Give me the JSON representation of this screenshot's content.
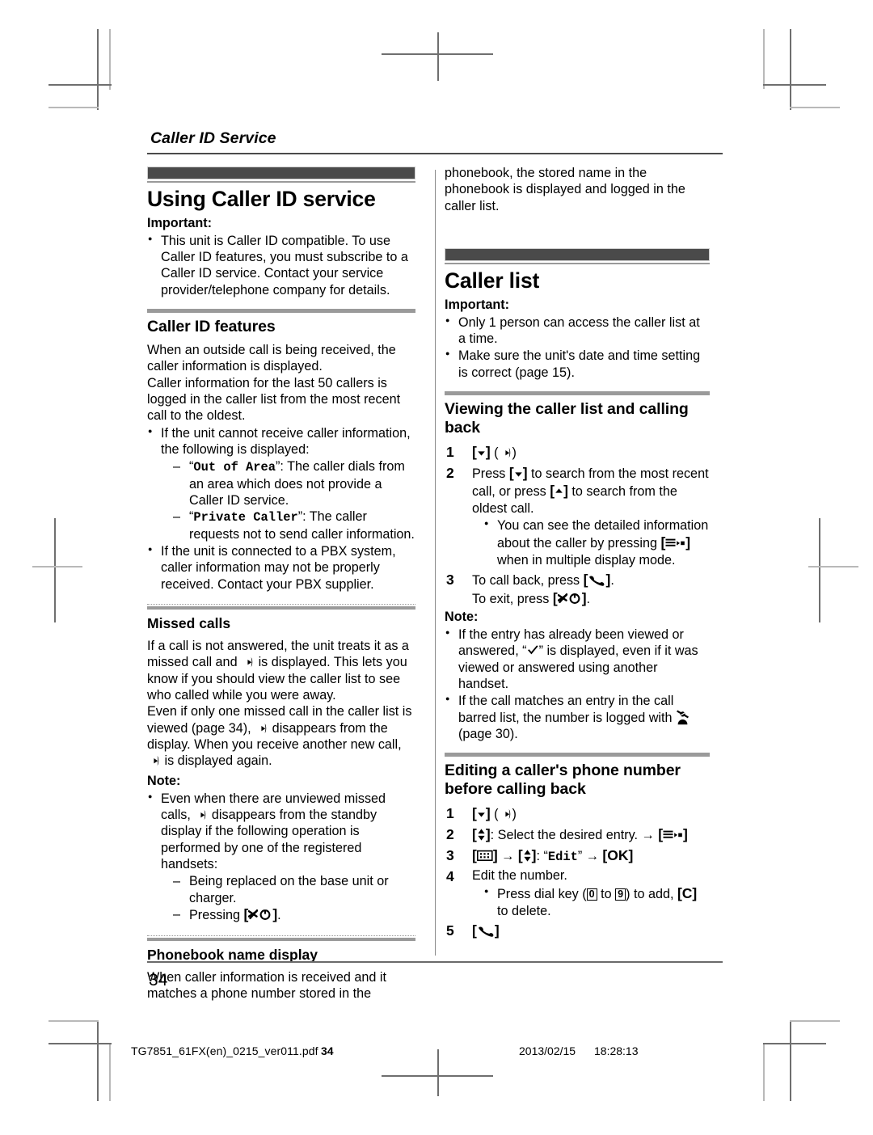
{
  "running_head": "Caller ID Service",
  "page_number": "34",
  "left_column": {
    "chapter_title": "Using Caller ID service",
    "important_label": "Important:",
    "important_bullets": [
      "This unit is Caller ID compatible. To use Caller ID features, you must subscribe to a Caller ID service. Contact your service provider/telephone company for details."
    ],
    "section_caller_id_features": {
      "heading": "Caller ID features",
      "paragraphs": [
        "When an outside call is being received, the caller information is displayed.",
        "Caller information for the last 50 callers is logged in the caller list from the most recent call to the oldest."
      ],
      "bullet_1_intro": "If the unit cannot receive caller information, the following is displayed:",
      "dash_items": [
        {
          "code": "Out of Area",
          "text": ": The caller dials from an area which does not provide a Caller ID service."
        },
        {
          "code": "Private Caller",
          "text": ": The caller requests not to send caller information."
        }
      ],
      "bullet_2": "If the unit is connected to a PBX system, caller information may not be properly received. Contact your PBX supplier."
    },
    "subsection_missed_calls": {
      "heading": "Missed calls",
      "para_1_a": "If a call is not answered, the unit treats it as a missed call and ",
      "para_1_b": " is displayed. This lets you know if you should view the caller list to see who called while you were away.",
      "para_2_a": "Even if only one missed call in the caller list is viewed (page 34), ",
      "para_2_b": " disappears from the display. When you receive another new call, ",
      "para_2_c": " is displayed again.",
      "note_label": "Note:",
      "note_bullet_a": "Even when there are unviewed missed calls, ",
      "note_bullet_b": " disappears from the standby display if the following operation is performed by one of the registered handsets:",
      "note_dash_1": "Being replaced on the base unit or charger.",
      "note_dash_2_prefix": "Pressing ",
      "note_dash_2_suffix": "."
    },
    "subsection_phonebook_name": {
      "heading": "Phonebook name display",
      "paragraph": "When caller information is received and it matches a phone number stored in the"
    }
  },
  "right_column": {
    "continuation": "phonebook, the stored name in the phonebook is displayed and logged in the caller list.",
    "chapter_title": "Caller list",
    "important_label": "Important:",
    "important_bullets": [
      "Only 1 person can access the caller list at a time.",
      "Make sure the unit's date and time setting is correct (page 15)."
    ],
    "section_viewing": {
      "heading": "Viewing the caller list and calling back",
      "step_2_text_a": "Press ",
      "step_2_text_b": " to search from the most recent call, or press ",
      "step_2_text_c": " to search from the oldest call.",
      "step_2_bullet_a": "You can see the detailed information about the caller by pressing ",
      "step_2_bullet_b": " when in multiple display mode.",
      "step_3_a": "To call back, press ",
      "step_3_b": ".",
      "step_3_c": "To exit, press ",
      "step_3_d": ".",
      "note_label": "Note:",
      "note_bullet_1_a": "If the entry has already been viewed or answered, “",
      "note_bullet_1_b": "” is displayed, even if it was viewed or answered using another handset.",
      "note_bullet_2_a": "If the call matches an entry in the call barred list, the number is logged with ",
      "note_bullet_2_b": " (page 30)."
    },
    "section_editing": {
      "heading": "Editing a caller's phone number before calling back",
      "step_2_text": ": Select the desired entry. ",
      "step_3_edit_label": "Edit",
      "step_3_ok_label": "OK",
      "step_4_text": "Edit the number.",
      "step_4_bullet_a": "Press dial key (",
      "step_4_bullet_b": " to ",
      "step_4_bullet_c": ") to add, ",
      "step_4_bullet_d": " to delete.",
      "key_c_label": "C",
      "digit_0": "0",
      "digit_9": "9"
    }
  },
  "imprint": {
    "filename": "TG7851_61FX(en)_0215_ver011.pdf",
    "page": "34",
    "date": "2013/02/15",
    "time": "18:28:13"
  }
}
